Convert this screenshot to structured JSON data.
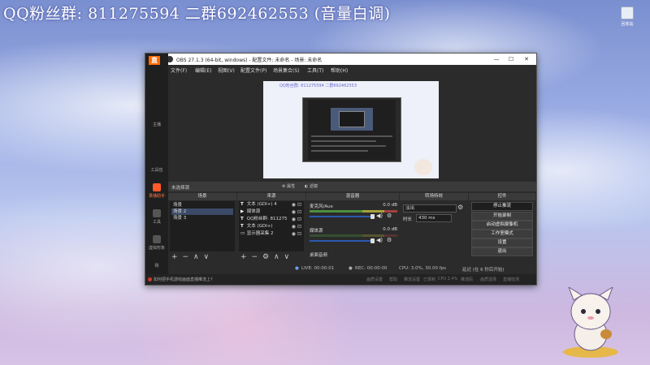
{
  "desktop": {
    "banner": "QQ粉丝群: 811275594 二群692462553 (音量白调)",
    "icon_label": "回收站"
  },
  "window": {
    "title": "OBS 27.1.3 (64-bit, windows) - 配置文件: 未命名 - 场景: 未命名",
    "menu": [
      "文件(F)",
      "编辑(E)",
      "视图(V)",
      "配置文件(P)",
      "场景集合(S)",
      "工具(T)",
      "帮助(H)"
    ],
    "controls": {
      "minimize": "—",
      "maximize": "☐",
      "close": "✕"
    }
  },
  "app_sidebar": {
    "logo": "直",
    "items": [
      {
        "label": "主播",
        "active": false
      },
      {
        "label": "工具包",
        "active": false
      },
      {
        "label": "录播助手",
        "active": true
      },
      {
        "label": "工具",
        "active": false
      },
      {
        "label": "虚拟形象",
        "active": false
      },
      {
        "label": "购",
        "active": false
      }
    ]
  },
  "preview": {
    "watermark": "QQ粉丝群: 811275594 二群692462553"
  },
  "source_toolbar": {
    "no_source": "未选择源",
    "properties": "属性",
    "filters": "滤镜"
  },
  "scenes": {
    "header": "场景",
    "items": [
      "场景",
      "场景 2",
      "场景 3"
    ],
    "selected": 1,
    "footer": [
      "+",
      "−",
      "∧",
      "∨"
    ]
  },
  "sources": {
    "header": "来源",
    "items": [
      {
        "icon": "T",
        "label": "文本 (GDI+) 4"
      },
      {
        "icon": "▶",
        "label": "媒体源"
      },
      {
        "icon": "T",
        "label": "QQ粉丝群: 811275"
      },
      {
        "icon": "T",
        "label": "文本 (GDI+)"
      },
      {
        "icon": "▭",
        "label": "显示器采集 2"
      }
    ],
    "footer": [
      "+",
      "−",
      "⚙",
      "∧",
      "∨"
    ]
  },
  "mixer": {
    "header": "混音器",
    "channels": [
      {
        "name": "麦克风/Aux",
        "db": "0.0 dB"
      },
      {
        "name": "媒体源",
        "db": "0.0 dB"
      },
      {
        "name": "桌面音频",
        "db": ""
      }
    ]
  },
  "transitions": {
    "header": "转场特效",
    "type": "淡出",
    "duration_label": "时长",
    "duration_value": "430 ms"
  },
  "controls": {
    "header": "控件",
    "buttons": [
      "停止推流",
      "开始录制",
      "启动虚拟摄像机",
      "工作室模式",
      "设置",
      "退出"
    ]
  },
  "status": {
    "live": "LIVE: 00:00:01",
    "rec": "REC: 00:00:00",
    "cpu": "CPU: 3.0%, 30.00 fps",
    "kb": "延迟 (在 6 秒后开始)"
  },
  "notice": {
    "text": "如何把手机游戏画面直播推流上?",
    "extras": [
      "画质设置",
      "帮助",
      "推流设置",
      "已录制",
      "CPU 2.4%",
      "推流码",
      "画质选择",
      "直播检测"
    ]
  },
  "colors": {
    "accent": "#ff5a2a",
    "obs_bg": "#2b2b2b",
    "selection": "#3b4a66",
    "meter_green": "#4c8f3e"
  }
}
